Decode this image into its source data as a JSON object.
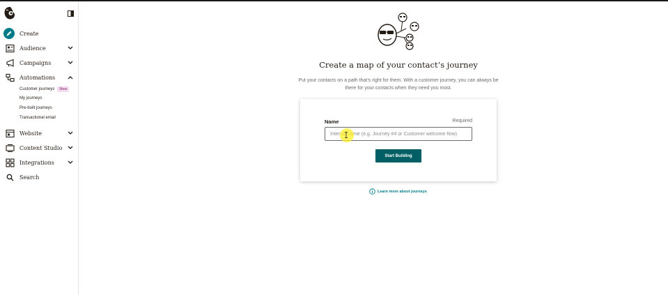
{
  "sidebar": {
    "items": [
      {
        "label": "Create",
        "icon": "pencil-icon"
      },
      {
        "label": "Audience",
        "icon": "audience-icon"
      },
      {
        "label": "Campaigns",
        "icon": "megaphone-icon"
      },
      {
        "label": "Automations",
        "icon": "automations-icon"
      },
      {
        "label": "Website",
        "icon": "website-icon"
      },
      {
        "label": "Content Studio",
        "icon": "content-studio-icon"
      },
      {
        "label": "Integrations",
        "icon": "integrations-icon"
      },
      {
        "label": "Search",
        "icon": "search-icon"
      }
    ],
    "automation_subitems": [
      {
        "label": "Customer journeys",
        "badge": "New"
      },
      {
        "label": "My journeys"
      },
      {
        "label": "Pre-built journeys"
      },
      {
        "label": "Transactional email"
      }
    ]
  },
  "main": {
    "heading": "Create a map of your contact’s journey",
    "description": "Put your contacts on a path that’s right for them. With a customer journey, you can always be there for your contacts when they need you most.",
    "form": {
      "name_label": "Name",
      "required_label": "Required",
      "name_placeholder": "Internal name (e.g. Journey #4 or Customer welcome flow)",
      "name_value": "",
      "submit_label": "Start Building"
    },
    "learn_more": "Learn more about journeys"
  },
  "colors": {
    "accent": "#007c89",
    "button": "#005e65",
    "badge_bg": "#f3dcf0"
  }
}
